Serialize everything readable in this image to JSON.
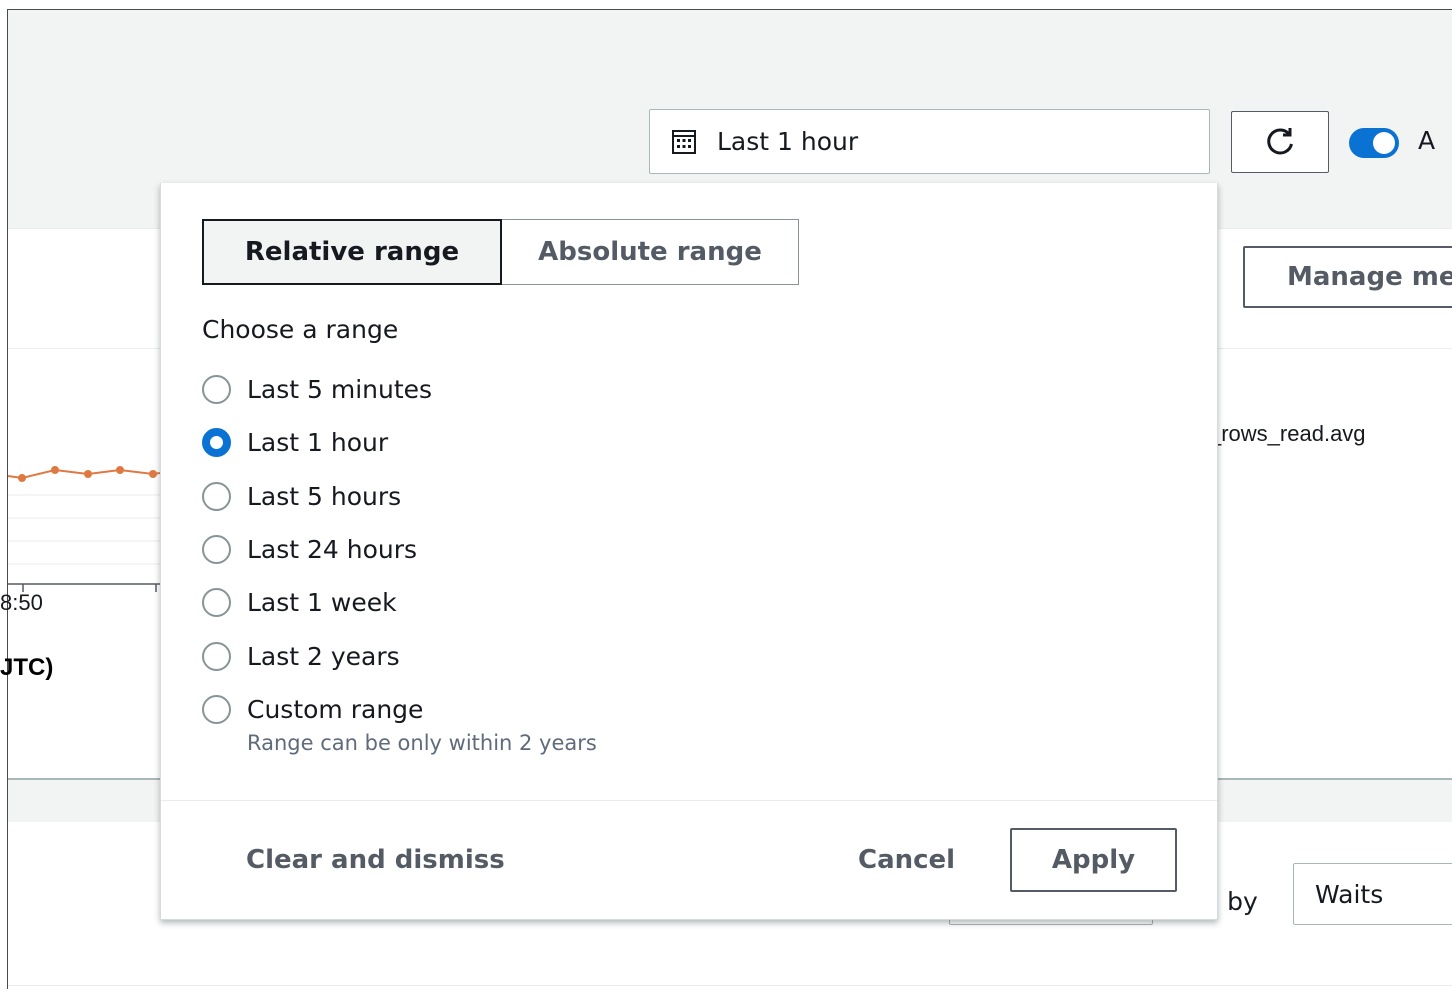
{
  "date_picker": {
    "value": "Last 1 hour",
    "icon": "calendar-icon"
  },
  "toolbar": {
    "refresh_icon": "refresh-icon",
    "auto_refresh_label": "A",
    "auto_refresh_on": true,
    "manage_label": "Manage me"
  },
  "chart": {
    "tick_label": "8:50",
    "axis_title": "JTC)",
    "legend": "_rows_read.avg",
    "series_color": "#e07941"
  },
  "slice": {
    "label": "ce by",
    "value": "Waits"
  },
  "popover": {
    "tabs": [
      "Relative range",
      "Absolute range"
    ],
    "active_tab": "Relative range",
    "heading": "Choose a range",
    "options": [
      {
        "label": "Last 5 minutes",
        "selected": false
      },
      {
        "label": "Last 1 hour",
        "selected": true
      },
      {
        "label": "Last 5 hours",
        "selected": false
      },
      {
        "label": "Last 24 hours",
        "selected": false
      },
      {
        "label": "Last 1 week",
        "selected": false
      },
      {
        "label": "Last 2 years",
        "selected": false
      },
      {
        "label": "Custom range",
        "selected": false
      }
    ],
    "custom_hint": "Range can be only within 2 years",
    "clear_label": "Clear and dismiss",
    "cancel_label": "Cancel",
    "apply_label": "Apply"
  },
  "colors": {
    "accent": "#0972d3",
    "text": "#16191f",
    "secondary_text": "#545b64"
  }
}
